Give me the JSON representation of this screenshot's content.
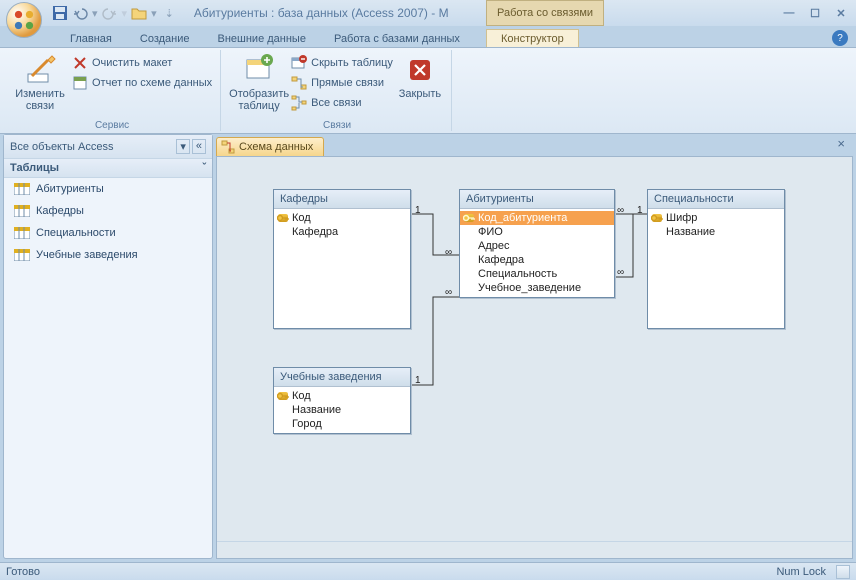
{
  "title": "Абитуриенты : база данных (Access 2007) - M",
  "context_tab_title": "Работа со связями",
  "ribbon_tabs": {
    "home": "Главная",
    "create": "Создание",
    "external": "Внешние данные",
    "db_tools": "Работа с базами данных",
    "designer": "Конструктор"
  },
  "ribbon": {
    "group_service": "Сервис",
    "group_relations": "Связи",
    "edit_rel": "Изменить связи",
    "clear_layout": "Очистить макет",
    "schema_report": "Отчет по схеме данных",
    "show_table": "Отобразить таблицу",
    "hide_table": "Скрыть таблицу",
    "direct_rel": "Прямые связи",
    "all_rel": "Все связи",
    "close": "Закрыть"
  },
  "nav": {
    "header": "Все объекты Access",
    "section_tables": "Таблицы",
    "items": [
      "Абитуриенты",
      "Кафедры",
      "Специальности",
      "Учебные заведения"
    ]
  },
  "doc_tab": "Схема данных",
  "tables": {
    "kafedry": {
      "title": "Кафедры",
      "fields": [
        "Код",
        "Кафедра"
      ]
    },
    "abitur": {
      "title": "Абитуриенты",
      "fields": [
        "Код_абитуриента",
        "ФИО",
        "Адрес",
        "Кафедра",
        "Специальность",
        "Учебное_заведение"
      ]
    },
    "spec": {
      "title": "Специальности",
      "fields": [
        "Шифр",
        "Название"
      ]
    },
    "uz": {
      "title": "Учебные заведения",
      "fields": [
        "Код",
        "Название",
        "Город"
      ]
    }
  },
  "status": {
    "ready": "Готово",
    "numlock": "Num Lock"
  }
}
